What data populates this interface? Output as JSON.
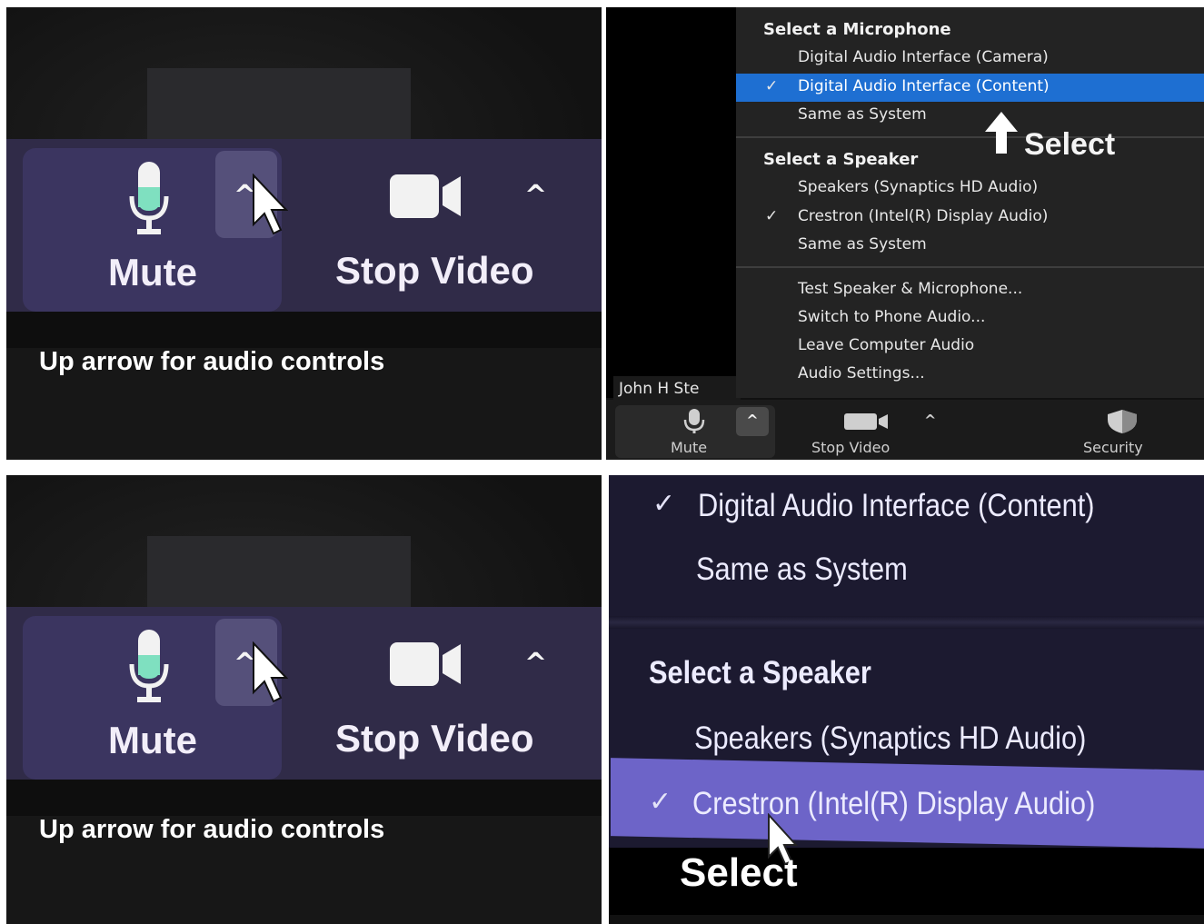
{
  "photo_panel": {
    "mute_label": "Mute",
    "video_label": "Stop Video",
    "caret": "^",
    "caption": "Up arrow for audio controls"
  },
  "zoom_menu": {
    "mic_header": "Select a Microphone",
    "mic_items": [
      "Digital Audio Interface (Camera)",
      "Digital Audio Interface (Content)",
      "Same as System"
    ],
    "speaker_header": "Select a Speaker",
    "speaker_items": [
      "Speakers (Synaptics HD Audio)",
      "Crestron (Intel(R) Display Audio)",
      "Same as System"
    ],
    "actions": [
      "Test Speaker & Microphone...",
      "Switch to Phone Audio...",
      "Leave Computer Audio",
      "Audio Settings..."
    ],
    "check": "✓",
    "annotation": "Select",
    "participant_name": "John H Ste",
    "toolbar": {
      "mute": "Mute",
      "caret": "^",
      "stop_video": "Stop Video",
      "security": "Security"
    },
    "highlight_color": "#1e6fd2"
  },
  "zoomed_menu": {
    "mic_selected": "Digital Audio Interface (Content)",
    "mic_same": "Same as System",
    "speaker_header": "Select a Speaker",
    "speaker_1": "Speakers (Synaptics HD Audio)",
    "speaker_2": "Crestron (Intel(R) Display Audio)",
    "check": "✓",
    "annotation": "Select",
    "highlight_color": "#6d64c8"
  }
}
